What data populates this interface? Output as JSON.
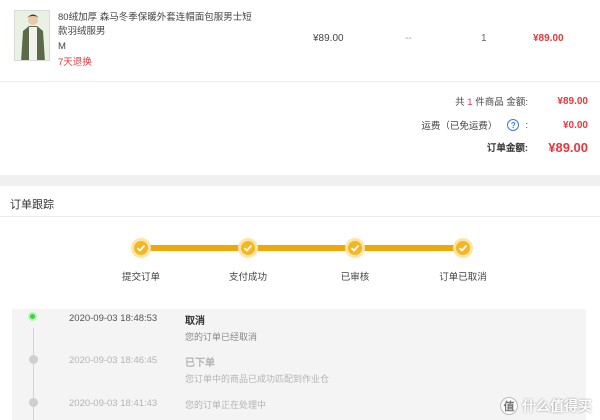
{
  "product": {
    "title": "80绒加厚 森马冬季保暖外套连帽面包服男士短款羽绒服男",
    "size": "M",
    "return_policy": "7天退换",
    "price": "¥89.00",
    "discount": "--",
    "quantity": "1",
    "subtotal": "¥89.00"
  },
  "summary": {
    "count_prefix": "共",
    "count": "1",
    "count_suffix": "件商品 金额:",
    "amount": "¥89.00",
    "shipping_label": "运费（已免运费）",
    "shipping_colon": ":",
    "shipping_value": "¥0.00",
    "total_label": "订单金额:",
    "total_value": "¥89.00"
  },
  "tracking": {
    "title": "订单跟踪",
    "steps": [
      {
        "label": "提交订单"
      },
      {
        "label": "支付成功"
      },
      {
        "label": "已审核"
      },
      {
        "label": "订单已取消"
      }
    ],
    "logs": [
      {
        "time": "2020-09-03 18:48:53",
        "status": "取消",
        "desc": "您的订单已经取消"
      },
      {
        "time": "2020-09-03 18:46:45",
        "status": "已下单",
        "desc": "您订单中的商品已成功匹配到作业仓"
      },
      {
        "time": "2020-09-03 18:41:43",
        "status": "",
        "desc": "您的订单正在处理中"
      }
    ]
  },
  "colors": {
    "accent_red": "#e4393c",
    "progress_orange": "#f0a808",
    "active_green": "#3bd43b",
    "help_blue": "#3a7bd5"
  },
  "watermark": {
    "icon": "值",
    "text": "什么值得买"
  }
}
